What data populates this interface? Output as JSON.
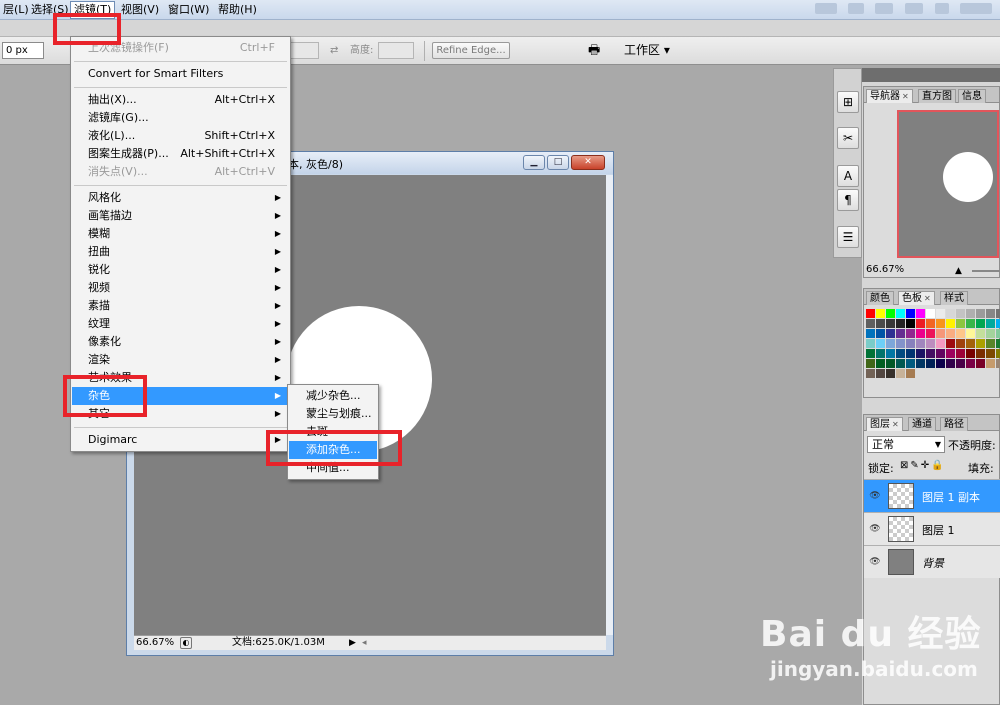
{
  "menubar": {
    "items": [
      {
        "label": "层(L)"
      },
      {
        "label": "选择(S)"
      },
      {
        "label": "滤镜(T)"
      },
      {
        "label": "视图(V)"
      },
      {
        "label": "窗口(W)"
      },
      {
        "label": "帮助(H)"
      }
    ]
  },
  "options_bar": {
    "feather_value": "0 px",
    "height_label": "高度:",
    "refine_edge": "Refine Edge...",
    "workspace_label": "工作区 ▾"
  },
  "filter_menu": {
    "last_filter": "上次滤镜操作(F)",
    "last_filter_shortcut": "Ctrl+F",
    "convert_smart": "Convert for Smart Filters",
    "items_group1": [
      {
        "label": "抽出(X)...",
        "shortcut": "Alt+Ctrl+X"
      },
      {
        "label": "滤镜库(G)...",
        "shortcut": ""
      },
      {
        "label": "液化(L)...",
        "shortcut": "Shift+Ctrl+X"
      },
      {
        "label": "图案生成器(P)...",
        "shortcut": "Alt+Shift+Ctrl+X"
      },
      {
        "label": "消失点(V)...",
        "shortcut": "Alt+Ctrl+V"
      }
    ],
    "items_group2": [
      {
        "label": "风格化"
      },
      {
        "label": "画笔描边"
      },
      {
        "label": "模糊"
      },
      {
        "label": "扭曲"
      },
      {
        "label": "锐化"
      },
      {
        "label": "视频"
      },
      {
        "label": "素描"
      },
      {
        "label": "纹理"
      },
      {
        "label": "像素化"
      },
      {
        "label": "渲染"
      },
      {
        "label": "艺术效果"
      },
      {
        "label": "杂色"
      },
      {
        "label": "其它"
      }
    ],
    "digimarc": "Digimarc"
  },
  "noise_submenu": {
    "items": [
      {
        "label": "减少杂色..."
      },
      {
        "label": "蒙尘与划痕..."
      },
      {
        "label": "去斑"
      },
      {
        "label": "添加杂色..."
      },
      {
        "label": "中间值..."
      }
    ]
  },
  "document": {
    "title": "本, 灰色/8)",
    "zoom": "66.67%",
    "doc_size": "文档:625.0K/1.03M"
  },
  "navigator": {
    "tabs": [
      "导航器",
      "直方图",
      "信息"
    ],
    "zoom": "66.67%"
  },
  "color_panel": {
    "tabs": [
      "颜色",
      "色板",
      "样式"
    ]
  },
  "layers_panel": {
    "tabs": [
      "图层",
      "通道",
      "路径"
    ],
    "blend_mode": "正常",
    "opacity_label": "不透明度:",
    "lock_label": "锁定:",
    "fill_label": "填充:",
    "layers": [
      {
        "name": "图层 1 副本",
        "selected": true
      },
      {
        "name": "图层 1",
        "selected": false
      },
      {
        "name": "背景",
        "selected": false
      }
    ]
  },
  "watermark": {
    "logo": "Bai du 经验",
    "url": "jingyan.baidu.com"
  },
  "colors": {
    "highlight": "#3399ff",
    "annotation_red": "#e8232a",
    "canvas_gray": "#808080"
  }
}
